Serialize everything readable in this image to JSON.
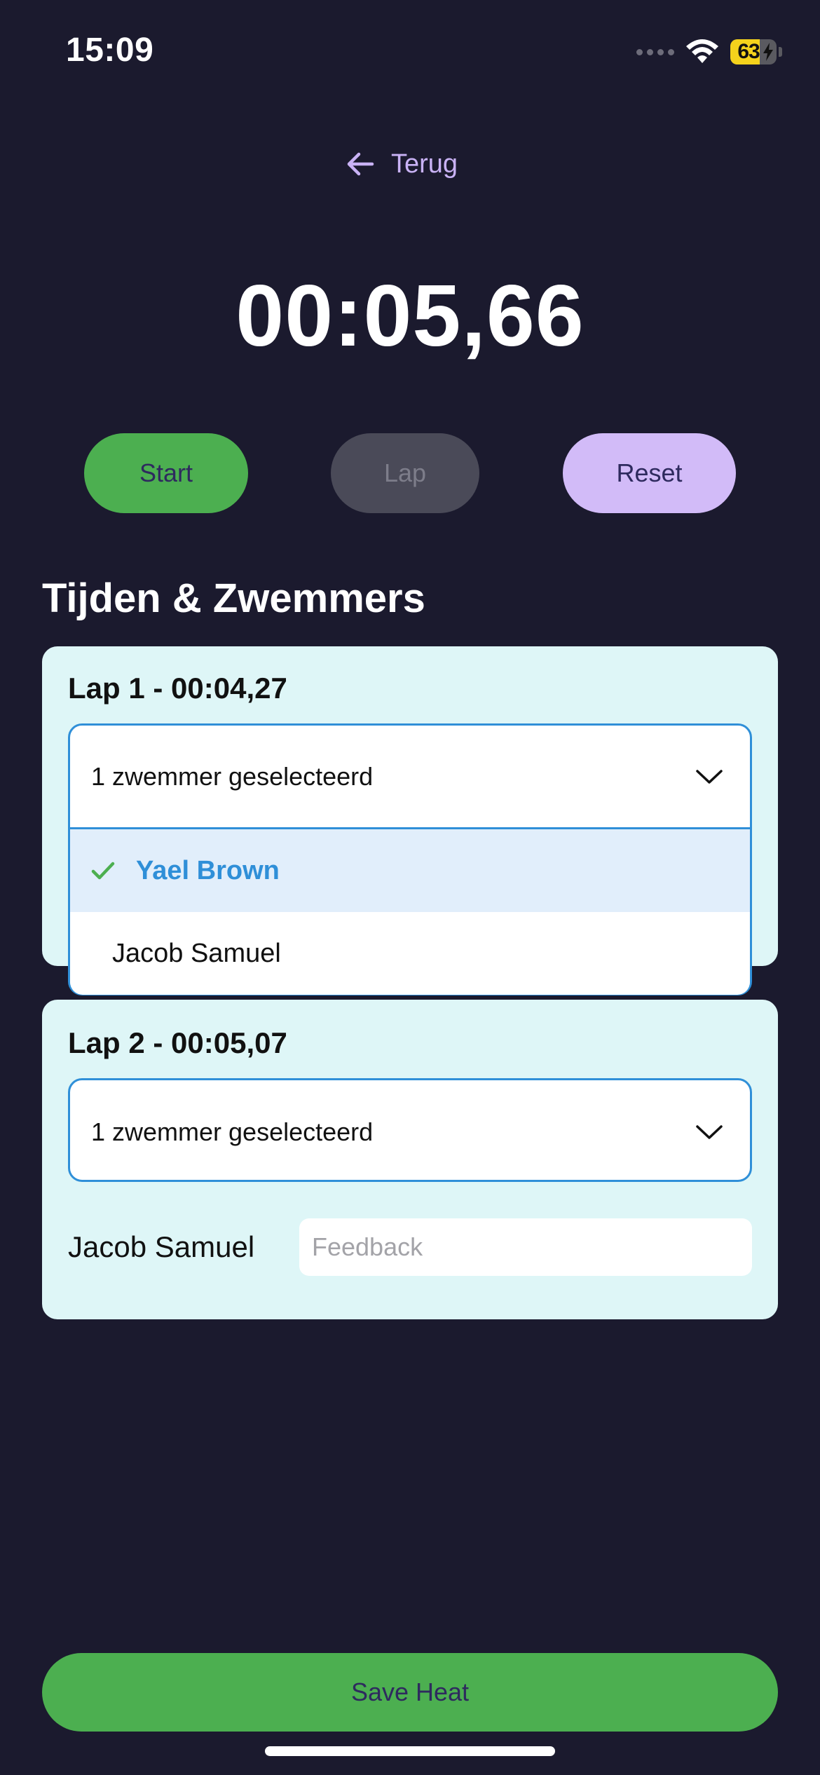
{
  "status_bar": {
    "time": "15:09",
    "battery_percent": 63,
    "battery_label": "63",
    "battery_charging": true,
    "wifi": "wifi-icon"
  },
  "nav": {
    "back_label": "Terug",
    "back_icon": "arrow-left-icon"
  },
  "stopwatch": {
    "time": "00:05,66"
  },
  "controls": {
    "start_label": "Start",
    "lap_label": "Lap",
    "lap_enabled": false,
    "reset_label": "Reset"
  },
  "section": {
    "title": "Tijden & Zwemmers"
  },
  "laps": [
    {
      "title": "Lap 1 - 00:04,27",
      "select_value": "1 zwemmer geselecteerd",
      "dropdown_open": true,
      "options": [
        {
          "label": "Yael Brown",
          "selected": true
        },
        {
          "label": "Jacob Samuel",
          "selected": false
        }
      ]
    },
    {
      "title": "Lap 2 - 00:05,07",
      "select_value": "1 zwemmer geselecteerd",
      "dropdown_open": false,
      "swimmers": [
        {
          "name": "Jacob Samuel",
          "feedback_value": "",
          "feedback_placeholder": "Feedback"
        }
      ]
    }
  ],
  "footer": {
    "save_label": "Save Heat"
  },
  "colors": {
    "background": "#1b1a2e",
    "card": "#def6f7",
    "accent_green": "#4caf50",
    "accent_purple": "#d2bbf8",
    "link_purple": "#c9b2f5",
    "select_blue": "#2f8fd8",
    "disabled_gray": "#4a4a58"
  }
}
